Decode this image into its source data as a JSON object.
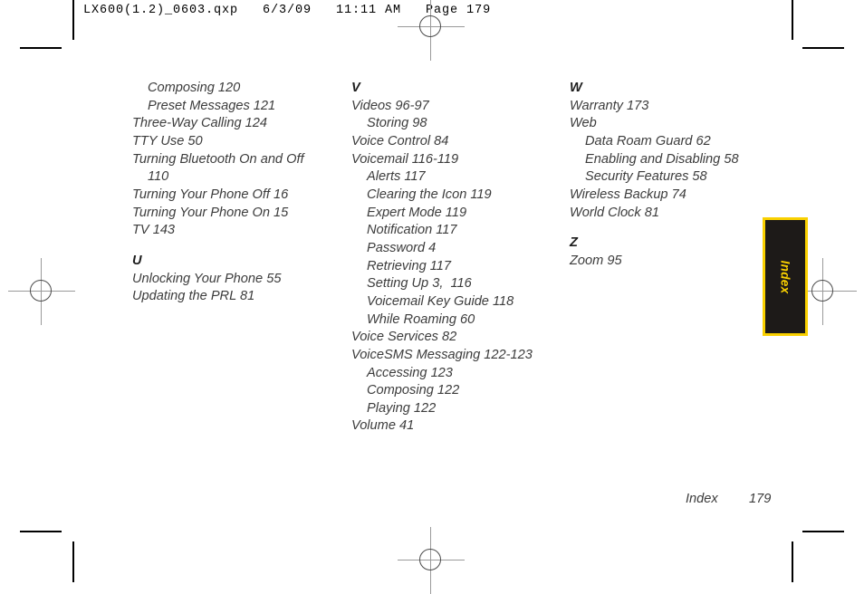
{
  "slug": {
    "text": "LX600(1.2)_0603.qxp   6/3/09   11:11 AM   Page 179"
  },
  "side_tab": {
    "label": "Index",
    "background_color": "#1d1a18",
    "border_color": "#f9d000",
    "text_color": "#f9d000"
  },
  "footer": {
    "label": "Index",
    "page_number": "179"
  },
  "columns": [
    {
      "id": "column-1",
      "blocks": [
        {
          "letter": null,
          "entries": [
            {
              "text": "Composing 120",
              "level": "sub"
            },
            {
              "text": "Preset Messages 121",
              "level": "sub"
            },
            {
              "text": "Three-Way Calling 124",
              "level": "main"
            },
            {
              "text": "TTY Use 50",
              "level": "main"
            },
            {
              "text": "Turning Bluetooth On and Off",
              "level": "main"
            },
            {
              "text": "110",
              "level": "cont"
            },
            {
              "text": "Turning Your Phone Off 16",
              "level": "main"
            },
            {
              "text": "Turning Your Phone On 15",
              "level": "main"
            },
            {
              "text": "TV 143",
              "level": "main"
            }
          ]
        },
        {
          "letter": "U",
          "entries": [
            {
              "text": "Unlocking Your Phone 55",
              "level": "main"
            },
            {
              "text": "Updating the PRL 81",
              "level": "main"
            }
          ]
        }
      ]
    },
    {
      "id": "column-2",
      "blocks": [
        {
          "letter": "V",
          "entries": [
            {
              "text": "Videos 96-97",
              "level": "main"
            },
            {
              "text": "Storing 98",
              "level": "sub"
            },
            {
              "text": "Voice Control 84",
              "level": "main"
            },
            {
              "text": "Voicemail 116-119",
              "level": "main"
            },
            {
              "text": "Alerts 117",
              "level": "sub"
            },
            {
              "text": "Clearing the Icon 119",
              "level": "sub"
            },
            {
              "text": "Expert Mode 119",
              "level": "sub"
            },
            {
              "text": "Notification 117",
              "level": "sub"
            },
            {
              "text": "Password 4",
              "level": "sub"
            },
            {
              "text": "Retrieving 117",
              "level": "sub"
            },
            {
              "text": "Setting Up 3,  116",
              "level": "sub"
            },
            {
              "text": "Voicemail Key Guide 118",
              "level": "sub"
            },
            {
              "text": "While Roaming 60",
              "level": "sub"
            },
            {
              "text": "Voice Services 82",
              "level": "main"
            },
            {
              "text": "VoiceSMS Messaging 122-123",
              "level": "main"
            },
            {
              "text": "Accessing 123",
              "level": "sub"
            },
            {
              "text": "Composing 122",
              "level": "sub"
            },
            {
              "text": "Playing 122",
              "level": "sub"
            },
            {
              "text": "Volume 41",
              "level": "main"
            }
          ]
        }
      ]
    },
    {
      "id": "column-3",
      "blocks": [
        {
          "letter": "W",
          "entries": [
            {
              "text": "Warranty 173",
              "level": "main"
            },
            {
              "text": "Web",
              "level": "main"
            },
            {
              "text": "Data Roam Guard 62",
              "level": "sub"
            },
            {
              "text": "Enabling and Disabling 58",
              "level": "sub"
            },
            {
              "text": "Security Features 58",
              "level": "sub"
            },
            {
              "text": "Wireless Backup 74",
              "level": "main"
            },
            {
              "text": "World Clock 81",
              "level": "main"
            }
          ]
        },
        {
          "letter": "Z",
          "entries": [
            {
              "text": "Zoom 95",
              "level": "main"
            }
          ]
        }
      ]
    }
  ]
}
